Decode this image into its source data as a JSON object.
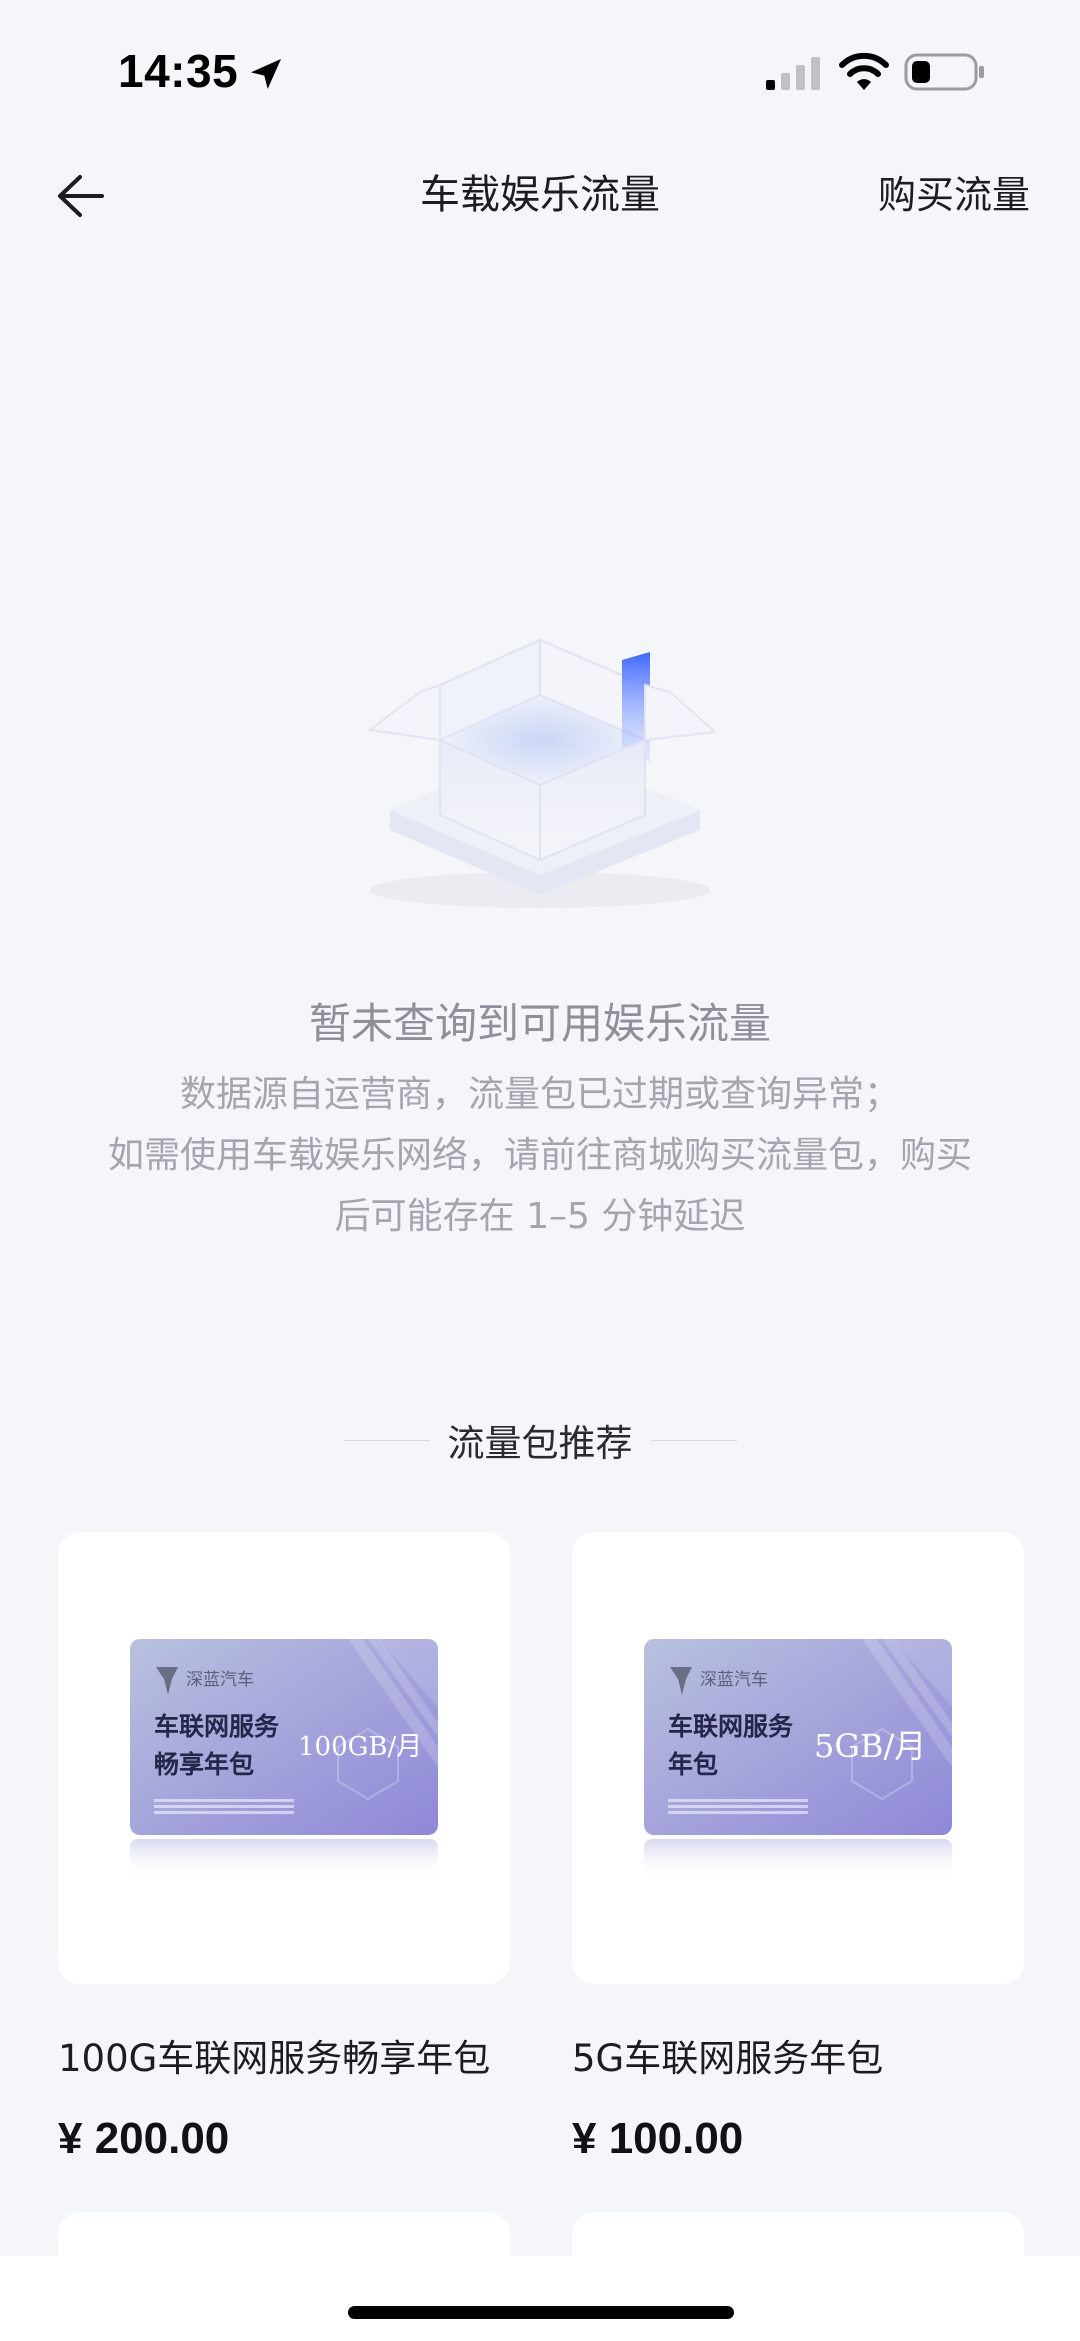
{
  "status_bar": {
    "time": "14:35",
    "icons": [
      "location-arrow-icon",
      "cellular-signal-icon",
      "wifi-icon",
      "battery-icon"
    ]
  },
  "nav": {
    "title": "车载娱乐流量",
    "action_label": "购买流量",
    "back_icon": "back-arrow-icon"
  },
  "empty_state": {
    "illustration": "empty-box-icon",
    "title": "暂未查询到可用娱乐流量",
    "description_lines": [
      "数据源自运营商，流量包已过期或查询异常；",
      "如需使用车载娱乐网络，请前往商城购买流量包，购买",
      "后可能存在 1–5 分钟延迟"
    ]
  },
  "recommend": {
    "section_title": "流量包推荐",
    "products": [
      {
        "name": "100G车联网服务畅享年包",
        "price": "¥ 200.00",
        "card_brand": "深蓝汽车",
        "card_line1": "车联网服务",
        "card_line2": "畅享年包",
        "card_quota": "100GB/月"
      },
      {
        "name": "5G车联网服务年包",
        "price": "¥ 100.00",
        "card_brand": "深蓝汽车",
        "card_line1": "车联网服务",
        "card_line2": "年包",
        "card_quota": "5GB/月"
      }
    ]
  },
  "colors": {
    "background": "#f5f6f9",
    "card": "#ffffff",
    "card_gradient_start": "#b9c1de",
    "card_gradient_end": "#8f88d8",
    "muted_text": "#a3a6ae"
  }
}
